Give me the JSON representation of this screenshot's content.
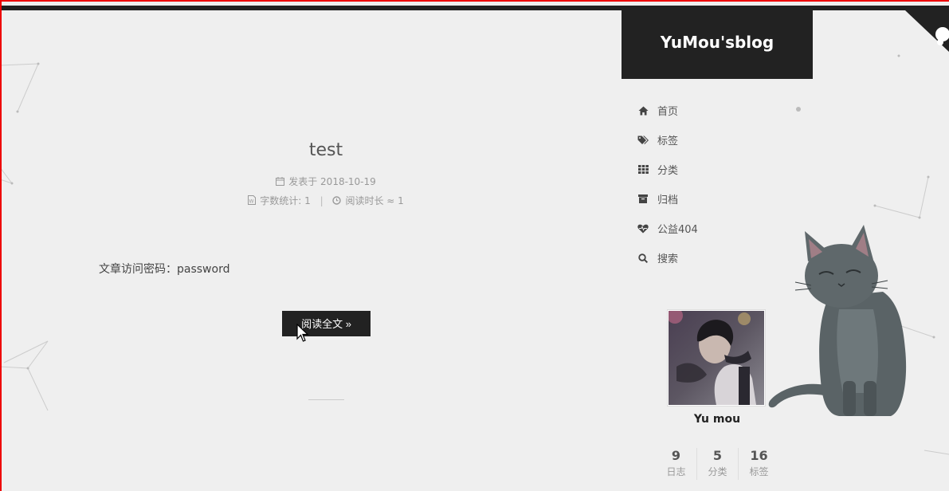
{
  "site": {
    "title": "YuMou'sblog"
  },
  "post": {
    "title": "test",
    "posted_label": "发表于",
    "posted_date": "2018-10-19",
    "wordcount_label": "字数统计:",
    "wordcount_value": "1",
    "separator": "|",
    "readtime_label": "阅读时长 ≈",
    "readtime_value": "1",
    "body": "文章访问密码：password",
    "read_more": "阅读全文 »"
  },
  "menu": {
    "items": [
      {
        "label": "首页",
        "icon": "home-icon",
        "active": true
      },
      {
        "label": "标签",
        "icon": "tags-icon"
      },
      {
        "label": "分类",
        "icon": "grid-icon"
      },
      {
        "label": "归档",
        "icon": "archive-icon"
      },
      {
        "label": "公益404",
        "icon": "heartbeat-icon"
      },
      {
        "label": "搜索",
        "icon": "search-icon"
      }
    ]
  },
  "author": {
    "name": "Yu mou",
    "stats": [
      {
        "num": "9",
        "label": "日志"
      },
      {
        "num": "5",
        "label": "分类"
      },
      {
        "num": "16",
        "label": "标签"
      }
    ]
  },
  "colors": {
    "frame": "#ee0000",
    "dark": "#222222",
    "background": "#efefef",
    "cat": "#5a6366"
  }
}
